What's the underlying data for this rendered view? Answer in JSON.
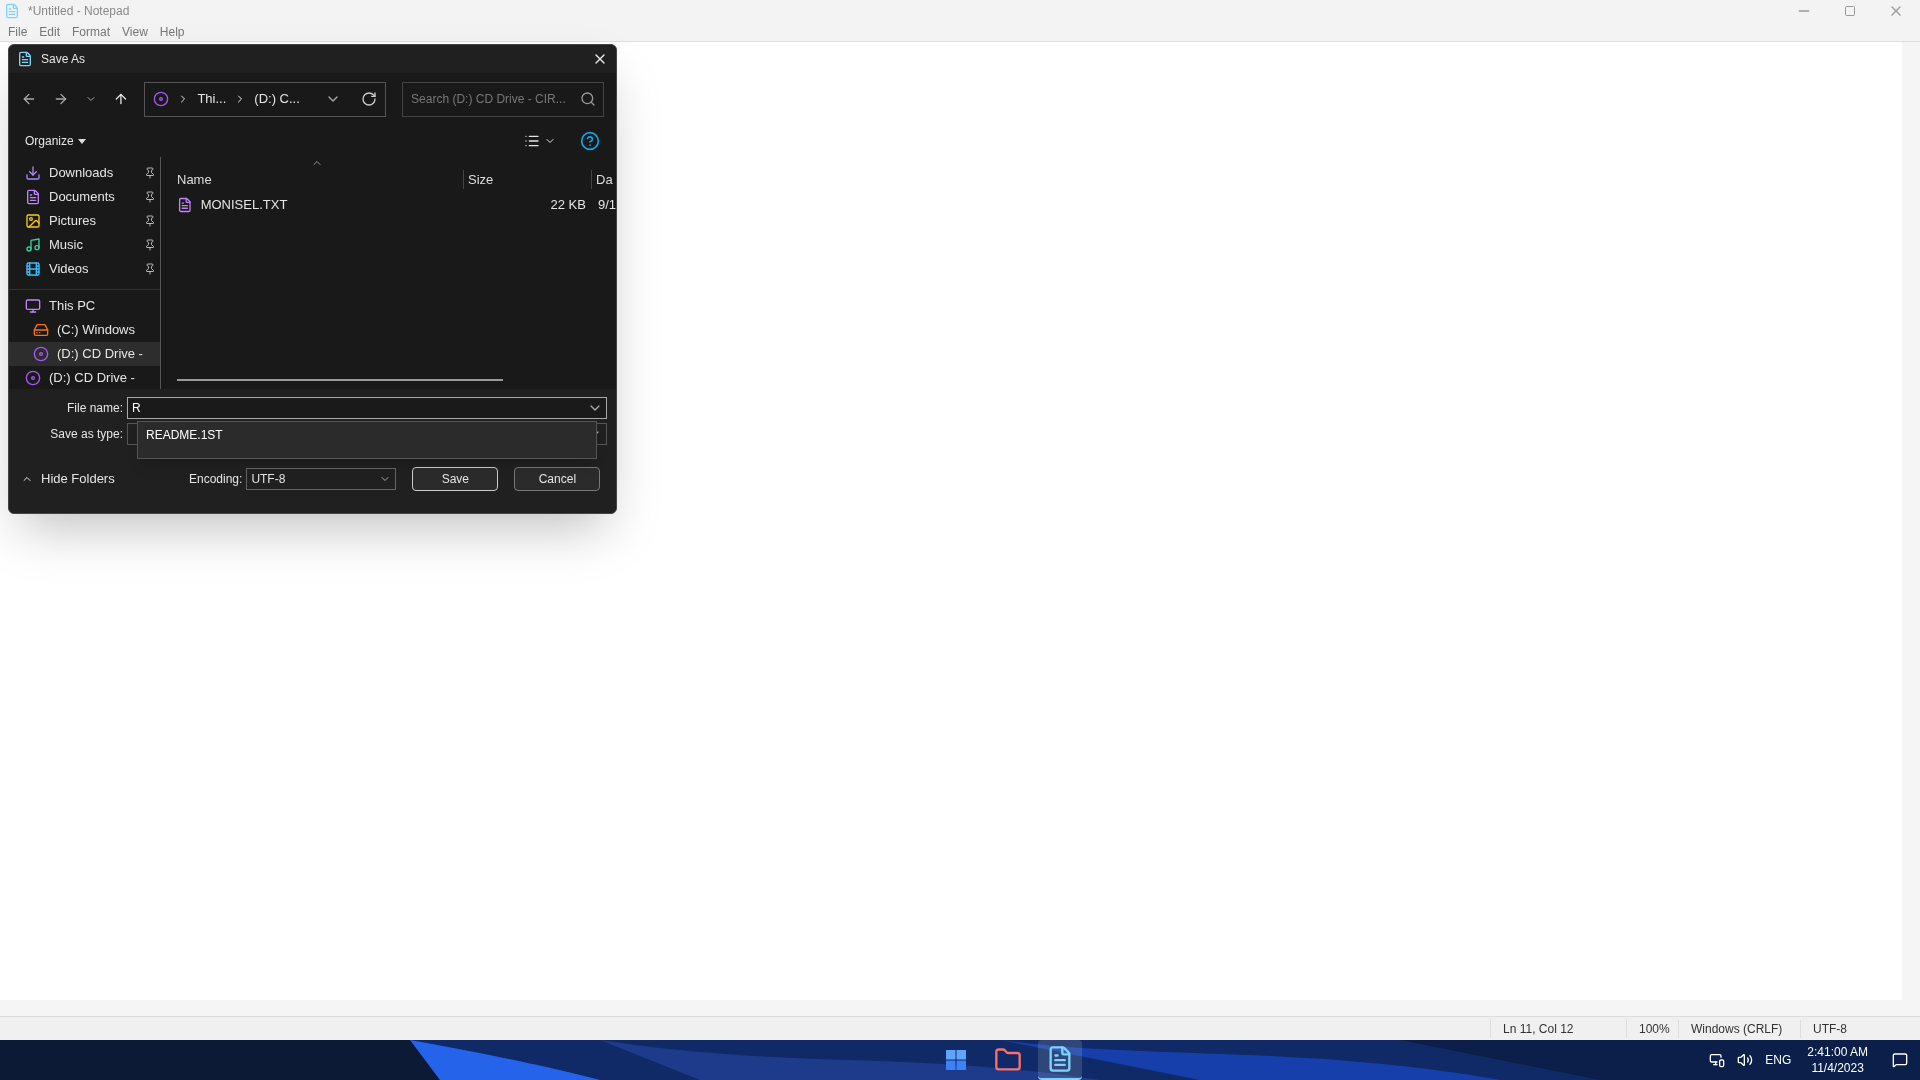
{
  "notepad": {
    "title": "*Untitled - Notepad",
    "menu": [
      "File",
      "Edit",
      "Format",
      "View",
      "Help"
    ],
    "status_bar": [
      "Ln 11, Col 12",
      "100%",
      "Windows (CRLF)",
      "UTF-8"
    ]
  },
  "dialog": {
    "title": "Save As",
    "breadcrumb": [
      "Thi...",
      "(D:) C..."
    ],
    "search": {
      "placeholder": "Search (D:) CD Drive - CIR..."
    },
    "organize": "Organize",
    "nav": [
      {
        "label": "Downloads",
        "kind": "downloads",
        "pinned": true,
        "selected": false
      },
      {
        "label": "Documents",
        "kind": "documents",
        "pinned": true,
        "selected": false
      },
      {
        "label": "Pictures",
        "kind": "pictures",
        "pinned": true,
        "selected": false
      },
      {
        "label": "Music",
        "kind": "music",
        "pinned": true,
        "selected": false
      },
      {
        "label": "Videos",
        "kind": "videos",
        "pinned": true,
        "selected": false
      },
      {
        "label": "This PC",
        "kind": "pc",
        "selected": false,
        "children": [
          {
            "label": "(C:) Windows",
            "kind": "drive",
            "selected": false
          },
          {
            "label": "(D:) CD Drive -",
            "kind": "cd",
            "selected": true
          }
        ]
      },
      {
        "label": "(D:) CD Drive -",
        "kind": "cd",
        "selected": false
      }
    ],
    "columns": [
      "Name",
      "Size",
      "Da"
    ],
    "rows": [
      {
        "name": "MONISEL.TXT",
        "size": "22 KB",
        "column_3": "9/1"
      }
    ],
    "file_name": {
      "label": "File name:",
      "value": "R",
      "suggestions": [
        "README.1ST"
      ]
    },
    "save_as_type": {
      "label": "Save as type:"
    },
    "hide_folders": "Hide Folders",
    "encoding": {
      "label": "Encoding:",
      "value": "UTF-8"
    },
    "buttons": [
      "Save",
      "Cancel"
    ]
  },
  "taskbar": {
    "apps": [
      {
        "kind": "start",
        "selected": false
      },
      {
        "kind": "explorer",
        "selected": false
      },
      {
        "kind": "notepad",
        "selected": true
      }
    ],
    "tray": {
      "language": "ENG",
      "time": "2:41:00 AM",
      "date": "11/4/2023"
    }
  }
}
